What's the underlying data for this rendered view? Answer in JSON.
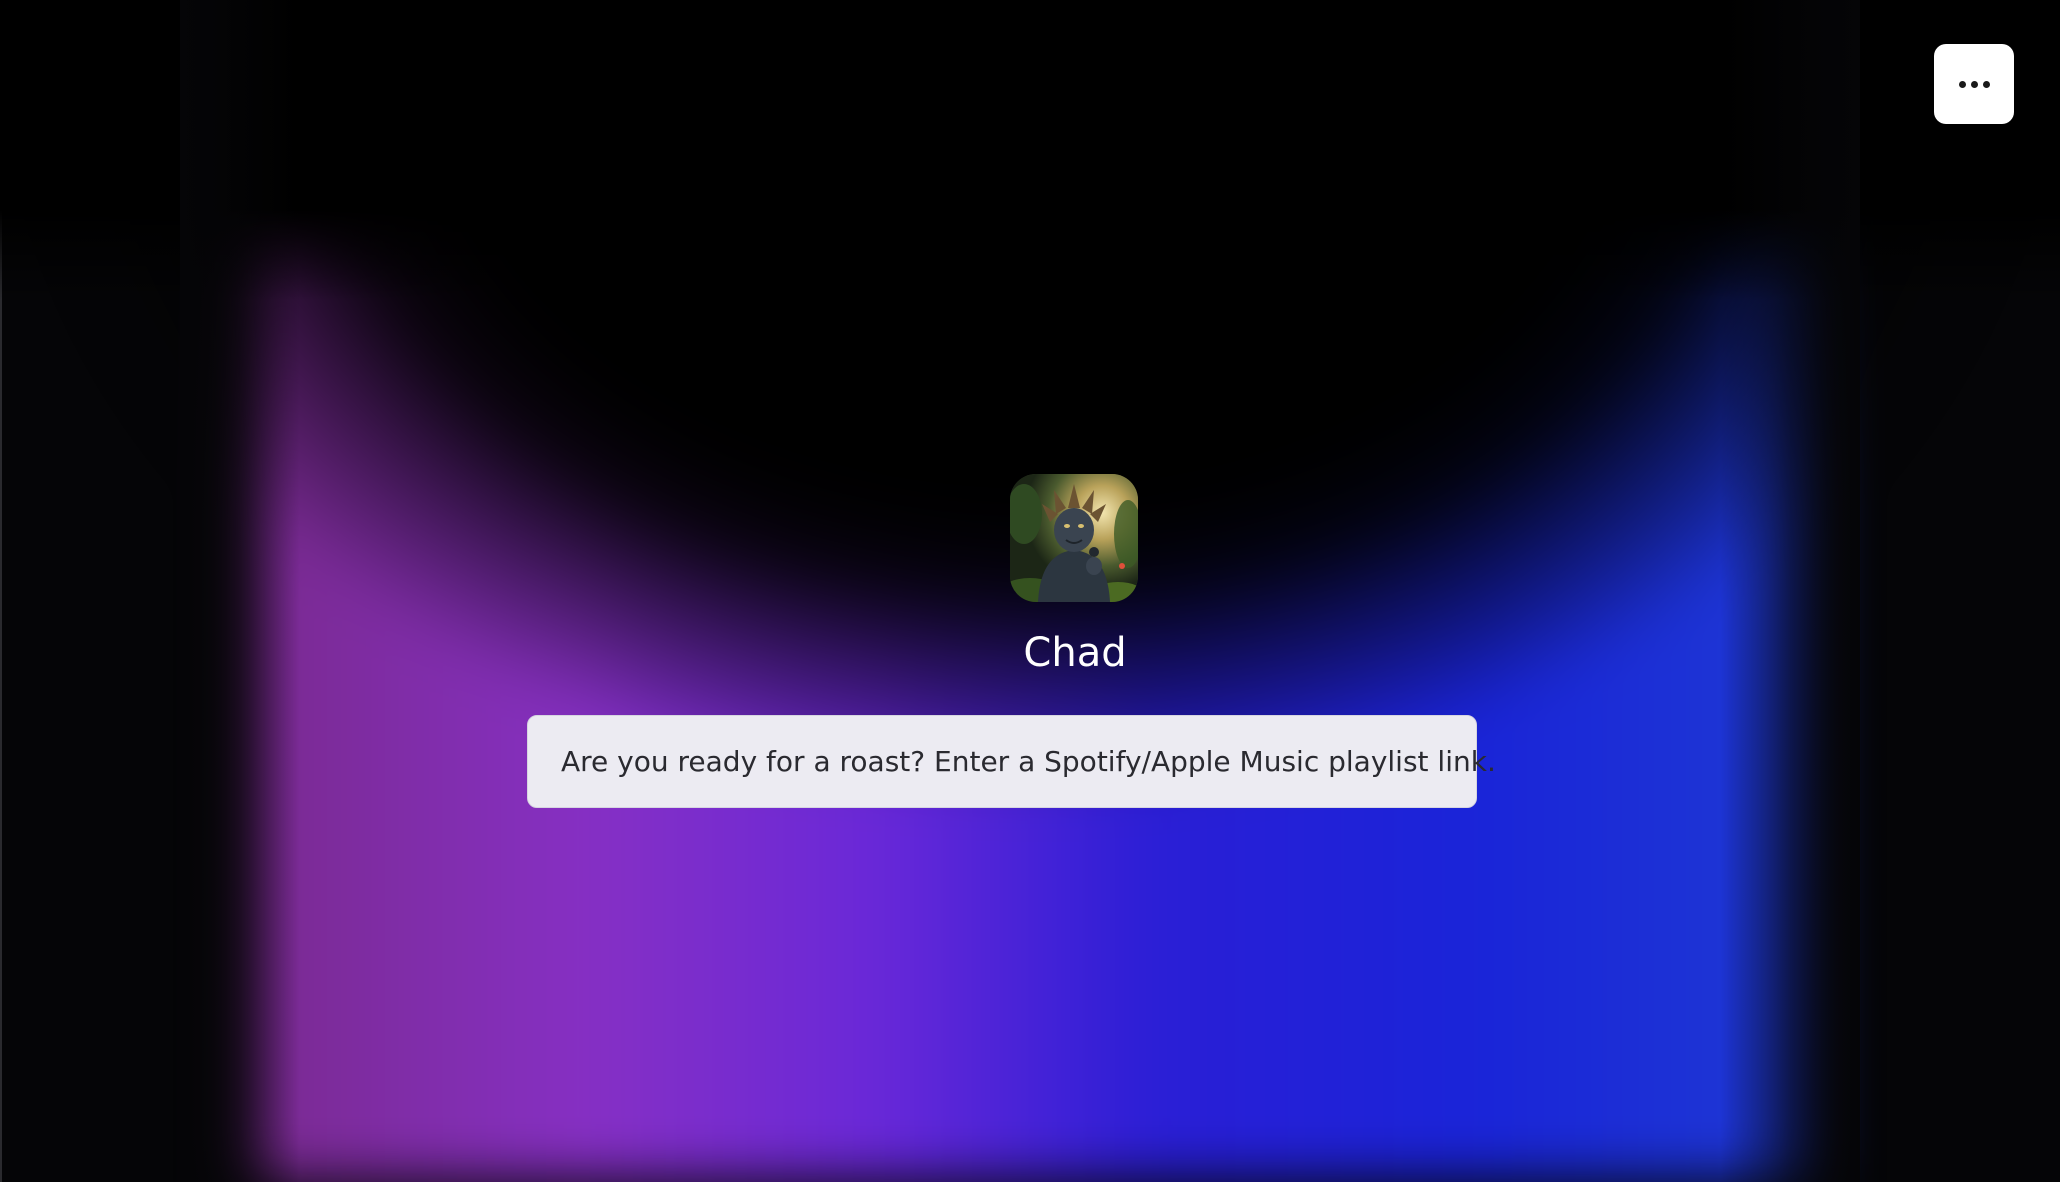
{
  "agent": {
    "name": "Chad",
    "avatar_icon": "jungle-creature-avatar"
  },
  "prompt": {
    "text": "Are you ready for a roast? Enter a Spotify/Apple Music playlist link."
  },
  "menu": {
    "icon": "more-horizontal-icon"
  },
  "colors": {
    "background": "#050507",
    "gradient_left": "#8630c4",
    "gradient_right": "#1a24d8",
    "prompt_bg": "#ecebf2"
  }
}
